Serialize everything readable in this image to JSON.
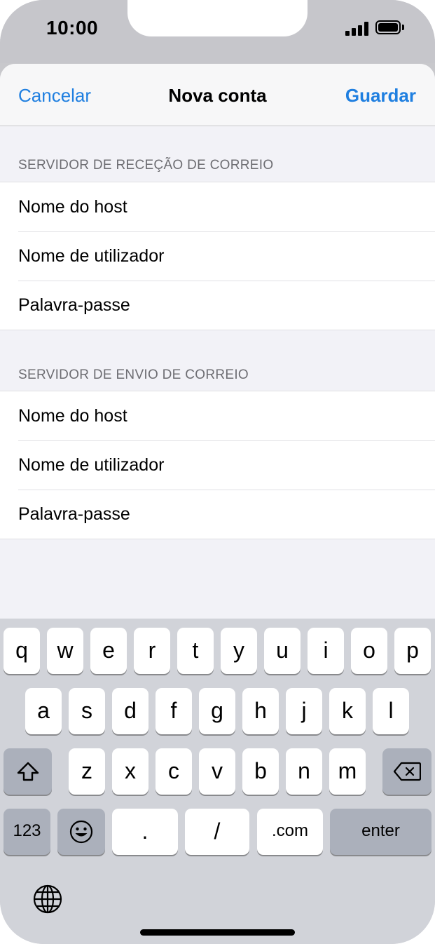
{
  "status": {
    "time": "10:00"
  },
  "nav": {
    "cancel": "Cancelar",
    "title": "Nova conta",
    "save": "Guardar"
  },
  "incoming": {
    "header": "SERVIDOR DE RECEÇÃO DE CORREIO",
    "rows": [
      "Nome do host",
      "Nome de utilizador",
      "Palavra-passe"
    ]
  },
  "outgoing": {
    "header": "SERVIDOR DE ENVIO DE CORREIO",
    "rows": [
      "Nome do host",
      "Nome de utilizador",
      "Palavra-passe"
    ]
  },
  "keyboard": {
    "row1": [
      "q",
      "w",
      "e",
      "r",
      "t",
      "y",
      "u",
      "i",
      "o",
      "p"
    ],
    "row2": [
      "a",
      "s",
      "d",
      "f",
      "g",
      "h",
      "j",
      "k",
      "l"
    ],
    "row3": [
      "z",
      "x",
      "c",
      "v",
      "b",
      "n",
      "m"
    ],
    "numbers": "123",
    "dot": ".",
    "slash": "/",
    "dotcom": ".com",
    "enter": "enter",
    "icons": {
      "shift": "shift-icon",
      "delete": "delete-icon",
      "emoji": "emoji-icon",
      "globe": "globe-icon"
    }
  },
  "colors": {
    "accent": "#1f7fe0",
    "background": "#f2f2f7",
    "keyboard": "#d1d3d9"
  }
}
